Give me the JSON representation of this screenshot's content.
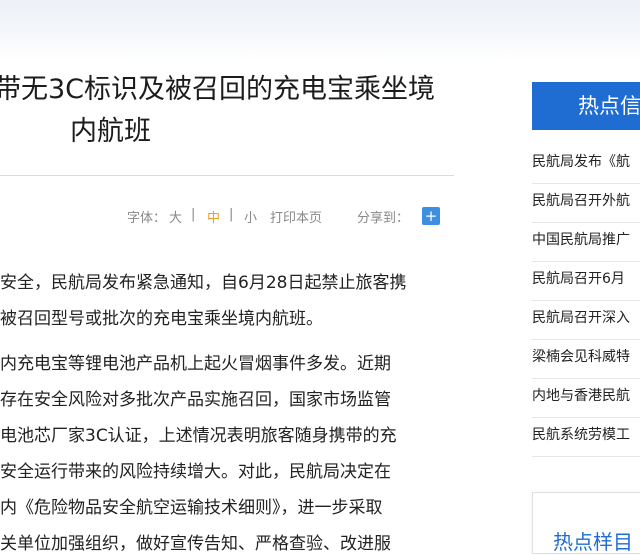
{
  "article": {
    "title_line1": "带无3C标识及被召回的充电宝乘坐境",
    "title_line2": "内航班",
    "tools": {
      "font_label": "字体：",
      "size_large": "大",
      "size_medium": "中",
      "size_small": "小",
      "separator": "|",
      "print": "打印本页",
      "share": "分享到：",
      "share_button": "+"
    },
    "lines": [
      "安全，民航局发布紧急通知，自6月28日起禁止旅客携",
      "被召回型号或批次的充电宝乘坐境内航班。",
      "内充电宝等锂电池产品机上起火冒烟事件多发。近期",
      "存在安全风险对多批次产品实施召回，国家市场监管",
      "电池芯厂家3C认证，上述情况表明旅客随身携带的充",
      "安全运行带来的风险持续增大。对此，民航局决定在",
      "内《危险物品安全航空运输技术细则》，进一步采取",
      "关单位加强组织，做好宣传告知、严格查验、改进服"
    ]
  },
  "sidebar": {
    "hot_title": "热点信",
    "items": [
      "民航局发布《航",
      "民航局召开外航",
      "中国民航局推广",
      "民航局召开6月",
      "民航局召开深入",
      "梁楠会见科威特",
      "内地与香港民航",
      "民航系统劳模工"
    ],
    "topics_title": "热点样目"
  },
  "colors": {
    "accent_blue": "#1f6dd3",
    "highlight_orange": "#f0a020"
  }
}
